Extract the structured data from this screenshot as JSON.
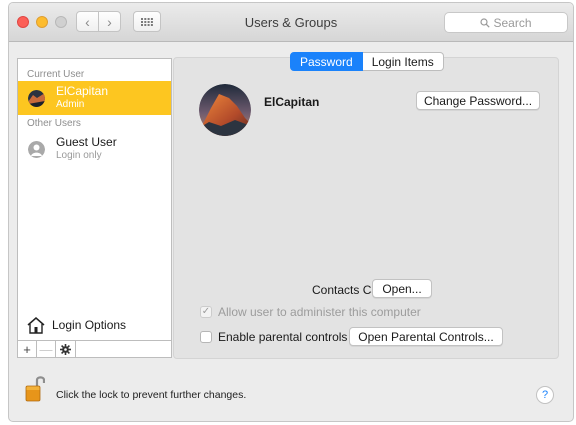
{
  "window": {
    "title": "Users & Groups"
  },
  "toolbar": {
    "back_glyph": "‹",
    "forward_glyph": "›",
    "show_all_icon": "grid-icon"
  },
  "search": {
    "placeholder": "Search"
  },
  "sidebar": {
    "current_user_header": "Current User",
    "current_user": {
      "name": "ElCapitan",
      "role": "Admin"
    },
    "other_users_header": "Other Users",
    "other_users": [
      {
        "name": "Guest User",
        "role": "Login only"
      }
    ],
    "login_options_label": "Login Options",
    "add_label": "+",
    "remove_label": "—"
  },
  "tabs": [
    {
      "label": "Password",
      "active": true
    },
    {
      "label": "Login Items",
      "active": false
    }
  ],
  "account": {
    "name": "ElCapitan",
    "change_password_label": "Change Password..."
  },
  "contacts": {
    "label": "Contacts Card:",
    "open_label": "Open..."
  },
  "options": {
    "allow_admin_label": "Allow user to administer this computer",
    "allow_admin_checked": true,
    "allow_admin_enabled": false,
    "parental_label": "Enable parental controls",
    "parental_checked": false,
    "open_parental_label": "Open Parental Controls..."
  },
  "footer": {
    "lock_text": "Click the lock to prevent further changes.",
    "help_label": "?"
  },
  "colors": {
    "accent": "#1a82fb",
    "selection": "#fdc620",
    "close": "#fc5f57",
    "minimize": "#fdbc2e"
  }
}
